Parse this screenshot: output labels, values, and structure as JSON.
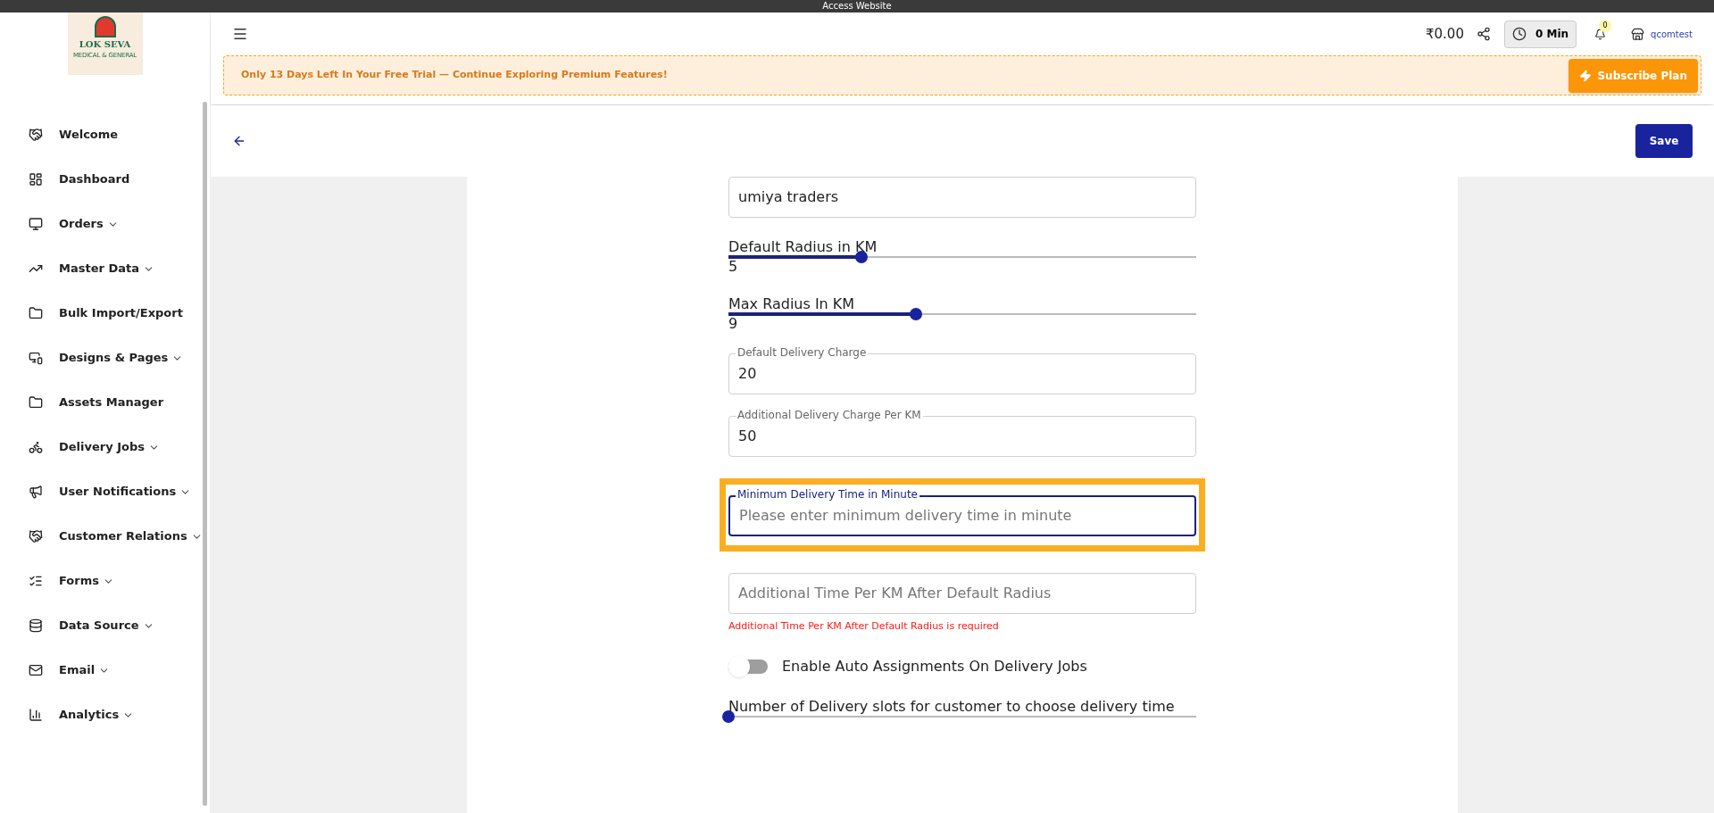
{
  "top_bar": {
    "title": "Access Website"
  },
  "sidebar": {
    "logo": {
      "title": "LOK SEVA",
      "subtitle": "MEDICAL & GENERAL"
    },
    "items": [
      {
        "label": "Welcome",
        "expandable": false
      },
      {
        "label": "Dashboard",
        "expandable": false
      },
      {
        "label": "Orders",
        "expandable": true
      },
      {
        "label": "Master Data",
        "expandable": true
      },
      {
        "label": "Bulk Import/Export",
        "expandable": false
      },
      {
        "label": "Designs & Pages",
        "expandable": true
      },
      {
        "label": "Assets Manager",
        "expandable": false
      },
      {
        "label": "Delivery Jobs",
        "expandable": true
      },
      {
        "label": "User Notifications",
        "expandable": true
      },
      {
        "label": "Customer Relations",
        "expandable": true
      },
      {
        "label": "Forms",
        "expandable": true
      },
      {
        "label": "Data Source",
        "expandable": true
      },
      {
        "label": "Email",
        "expandable": true
      },
      {
        "label": "Analytics",
        "expandable": true
      }
    ]
  },
  "header": {
    "balance": "₹0.00",
    "timer": "0 Min",
    "notifications": "0",
    "store": "qcomtest"
  },
  "trial_banner": {
    "message": "Only 13 Days Left In Your Free Trial — Continue Exploring Premium Features!",
    "button": "Subscribe Plan"
  },
  "toolbar": {
    "save": "Save"
  },
  "form": [
    {
      "kind": "input",
      "value": "umiya traders",
      "focused": false
    },
    {
      "kind": "slider",
      "label": "Default Radius in KM",
      "level": 0.285,
      "reading": "5"
    },
    {
      "kind": "slider",
      "label": "Max Radius In KM",
      "level": 0.4,
      "reading": "9"
    },
    {
      "kind": "input",
      "label": "Default Delivery Charge",
      "value": "20",
      "focused": false
    },
    {
      "kind": "input",
      "label": "Additional Delivery Charge Per KM",
      "value": "50",
      "focused": false
    },
    {
      "kind": "input",
      "label": "Minimum Delivery Time in Minute",
      "placeholder": "Please enter minimum delivery time in minute",
      "focused": true,
      "highlighted": true
    },
    {
      "kind": "input",
      "placeholder": "Additional Time Per KM After Default Radius",
      "focused": false,
      "error": "Additional Time Per KM After Default Radius is required"
    },
    {
      "kind": "toggle",
      "label": "Enable Auto Assignments On Delivery Jobs",
      "on": false
    },
    {
      "kind": "slider",
      "label": "Number of Delivery slots for customer to choose delivery time",
      "level": 0
    }
  ]
}
